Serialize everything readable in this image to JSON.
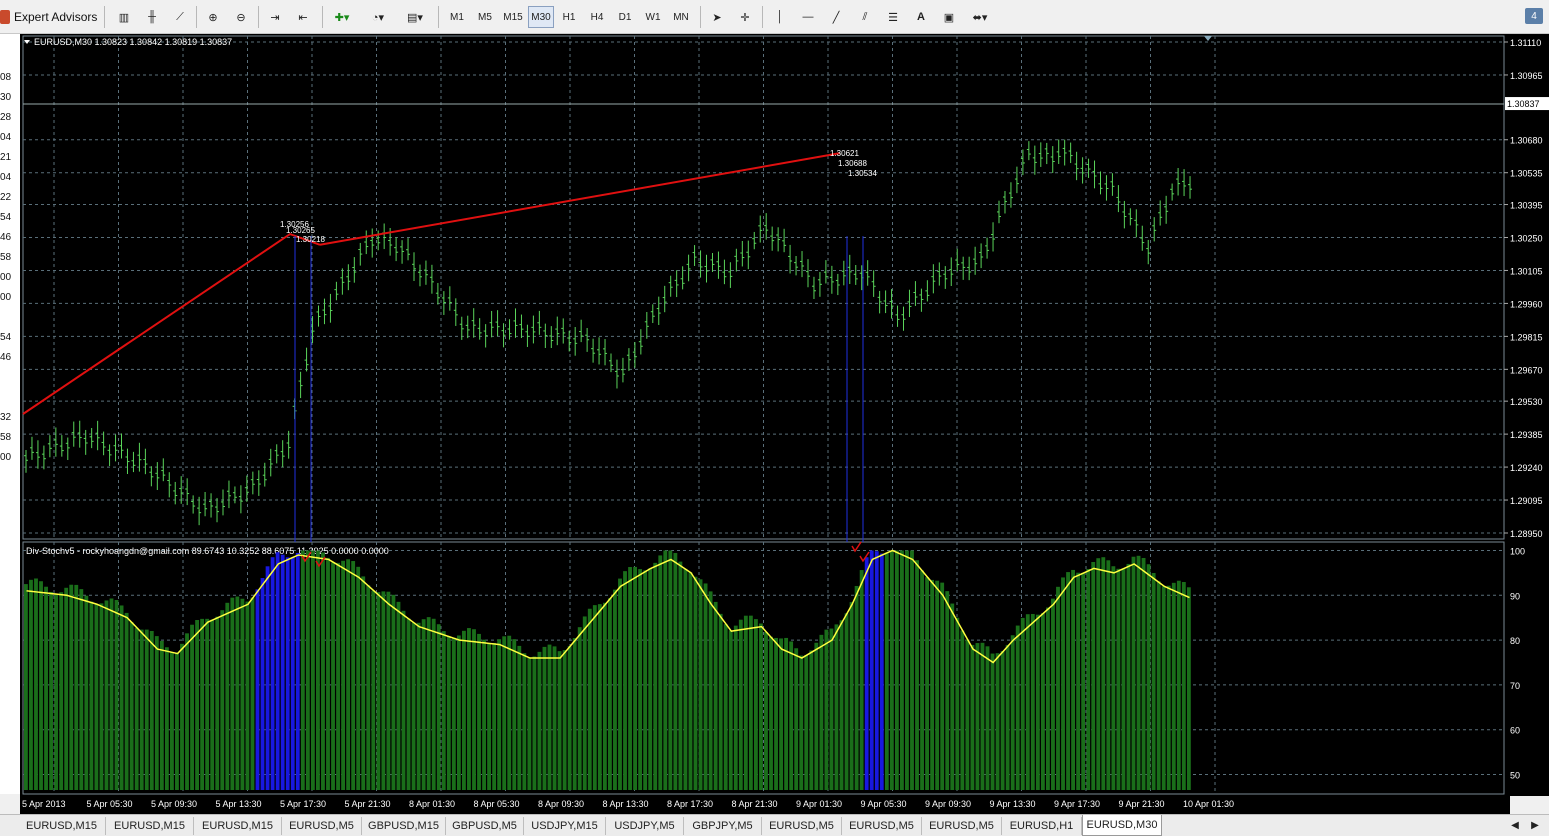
{
  "toolbar": {
    "expert_advisors_label": "Expert Advisors",
    "timeframes": [
      "M1",
      "M5",
      "M15",
      "M30",
      "H1",
      "H4",
      "D1",
      "W1",
      "MN"
    ],
    "active_timeframe": "M30",
    "text_tool_label": "A",
    "corner_badge": "4"
  },
  "left_panel": {
    "values": [
      "08",
      "30",
      "28",
      "04",
      "21",
      "04",
      "22",
      "54",
      "46",
      "58",
      "00",
      "00",
      "54",
      "46",
      "32",
      "58",
      "00"
    ]
  },
  "chart": {
    "header": "EURUSD,M30  1.30823 1.30842 1.30819 1.30837",
    "current_price": "1.30837",
    "price_labels": [
      "1.31110",
      "1.30965",
      "1.30680",
      "1.30535",
      "1.30395",
      "1.30250",
      "1.30105",
      "1.29960",
      "1.29815",
      "1.29670",
      "1.29530",
      "1.29385",
      "1.29240",
      "1.29095",
      "1.28950"
    ],
    "divergence_labels_a": [
      "1.30256",
      "1.30265",
      "1.30218"
    ],
    "divergence_labels_b": [
      "1.30621",
      "1.30688",
      "1.30534"
    ],
    "indicator_header": "Div-Stochv5 - rockyhoangdn@gmail.com 89.6743 10.3252 88.6075 11.3925 0.0000 0.0000",
    "indicator_levels": [
      "100",
      "90",
      "80",
      "70",
      "60",
      "50"
    ],
    "time_labels": [
      "5 Apr 2013",
      "5 Apr 05:30",
      "5 Apr 09:30",
      "5 Apr 13:30",
      "5 Apr 17:30",
      "5 Apr 21:30",
      "8 Apr 01:30",
      "8 Apr 05:30",
      "8 Apr 09:30",
      "8 Apr 13:30",
      "8 Apr 17:30",
      "8 Apr 21:30",
      "9 Apr 01:30",
      "9 Apr 05:30",
      "9 Apr 09:30",
      "9 Apr 13:30",
      "9 Apr 17:30",
      "9 Apr 21:30",
      "10 Apr 01:30"
    ],
    "colors": {
      "bull": "#2f9a2f",
      "candle": "#5ad45a",
      "line": "#e01010",
      "signal": "#ffff40",
      "hist": "#1a6e1a",
      "hist_div": "#1818e0",
      "grid": "#5a6f7a"
    }
  },
  "tabs": [
    "EURUSD,M15",
    "EURUSD,M15",
    "EURUSD,M15",
    "EURUSD,M5",
    "GBPUSD,M15",
    "GBPUSD,M5",
    "USDJPY,M15",
    "USDJPY,M5",
    "GBPJPY,M5",
    "EURUSD,M5",
    "EURUSD,M5",
    "EURUSD,M5",
    "EURUSD,H1",
    "EURUSD,M30"
  ],
  "active_tab": "EURUSD,M30"
}
